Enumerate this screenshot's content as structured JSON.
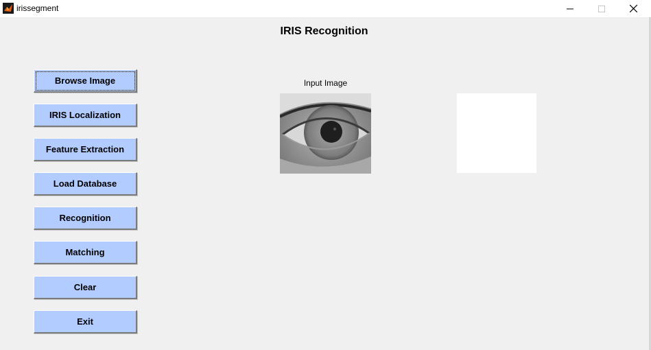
{
  "window": {
    "title": "irissegment",
    "controls": {
      "minimize_icon": "minimize-icon",
      "maximize_icon": "maximize-icon",
      "close_icon": "close-icon"
    }
  },
  "heading": "IRIS Recognition",
  "buttons": [
    {
      "label": "Browse Image"
    },
    {
      "label": "IRIS Localization"
    },
    {
      "label": "Feature Extraction"
    },
    {
      "label": "Load Database"
    },
    {
      "label": "Recognition"
    },
    {
      "label": "Matching"
    },
    {
      "label": "Clear"
    },
    {
      "label": "Exit"
    }
  ],
  "panels": {
    "input_caption": "Input Image"
  },
  "colors": {
    "button_face": "#b3ccff",
    "background": "#f0f0f0"
  }
}
